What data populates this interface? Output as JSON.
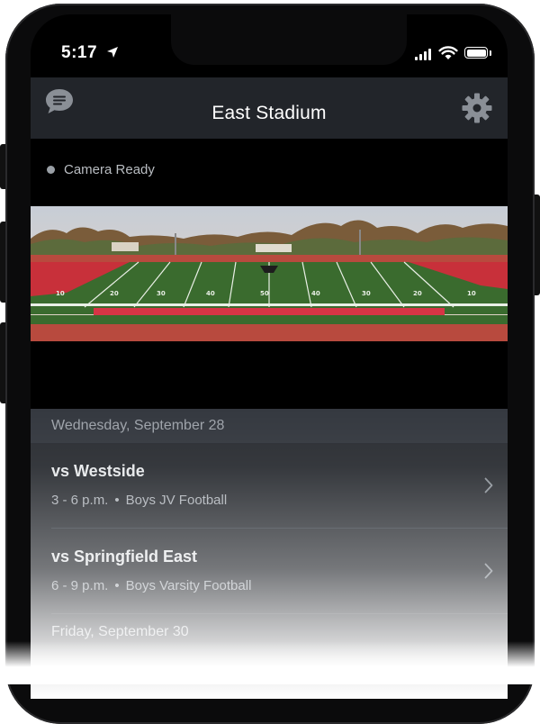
{
  "status_bar": {
    "time": "5:17",
    "icons": [
      "location-arrow-icon",
      "cellular-signal-icon",
      "wifi-icon",
      "battery-icon"
    ]
  },
  "navbar": {
    "title": "East Stadium",
    "left_icon": "chat-bubble-icon",
    "right_icon": "gear-icon"
  },
  "camera": {
    "status_text": "Camera Ready",
    "status_color": "#9aa0a6",
    "field_numbers": [
      "10",
      "20",
      "30",
      "40",
      "50",
      "40",
      "30",
      "20",
      "10"
    ]
  },
  "schedule": {
    "days": [
      {
        "date": "Wednesday, September 28",
        "events": [
          {
            "title": "vs Westside",
            "time": "3 - 6 p.m.",
            "separator": "•",
            "category": "Boys JV Football"
          },
          {
            "title": "vs Springfield East",
            "time": "6 - 9 p.m.",
            "separator": "•",
            "category": "Boys Varsity Football"
          }
        ]
      },
      {
        "date": "Friday, September 30",
        "events": []
      }
    ]
  },
  "colors": {
    "navbar_bg": "#22252a",
    "list_bg": "#2b2e33",
    "day_header_bg": "#353940",
    "turf": "#3a6b2e",
    "track": "#b84a3e",
    "endzone": "#c8303a"
  }
}
